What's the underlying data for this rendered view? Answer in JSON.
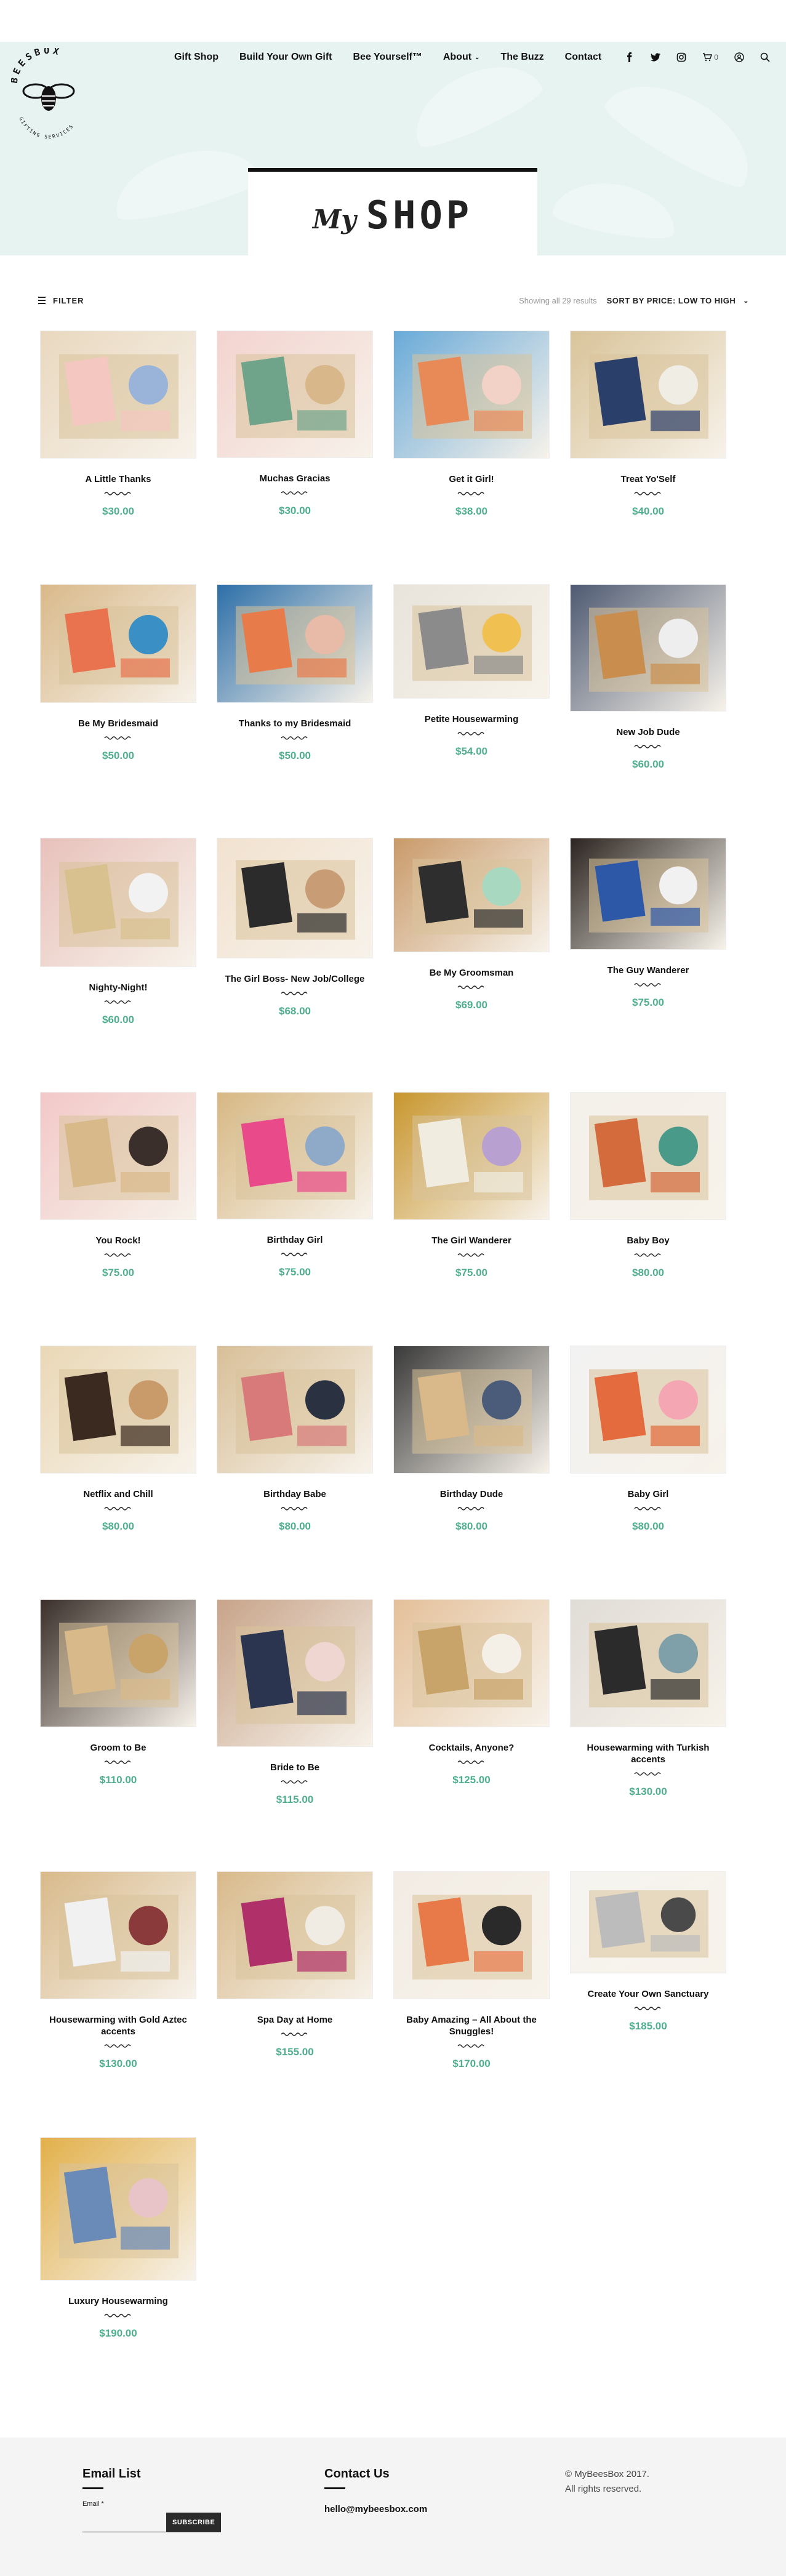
{
  "header": {
    "logo_text": "BEESBOX",
    "logo_subtext": "GIFTING SERVICES",
    "nav": [
      {
        "label": "Gift Shop"
      },
      {
        "label": "Build Your Own Gift"
      },
      {
        "label": "Bee Yourself™"
      },
      {
        "label": "About",
        "dropdown": true
      },
      {
        "label": "The Buzz"
      },
      {
        "label": "Contact"
      }
    ],
    "icons": [
      "facebook-icon",
      "twitter-icon",
      "instagram-icon",
      "cart-icon",
      "user-icon",
      "search-icon"
    ],
    "cart_count": "0"
  },
  "title": {
    "my": "My",
    "shop": "SHOP"
  },
  "toolbar": {
    "filter_label": "FILTER",
    "results_text": "Showing all 29 results",
    "sort_label": "SORT BY PRICE: LOW TO HIGH"
  },
  "colors": {
    "accent": "#4fae8e",
    "hero_bg": "#e6f3f1",
    "footer_bg": "#f4f4f4"
  },
  "products": [
    {
      "name": "A Little Thanks",
      "price": "$30.00"
    },
    {
      "name": "Muchas Gracias",
      "price": "$30.00"
    },
    {
      "name": "Get it Girl!",
      "price": "$38.00"
    },
    {
      "name": "Treat Yo'Self",
      "price": "$40.00"
    },
    {
      "name": "Be My Bridesmaid",
      "price": "$50.00"
    },
    {
      "name": "Thanks to my Bridesmaid",
      "price": "$50.00"
    },
    {
      "name": "Petite Housewarming",
      "price": "$54.00"
    },
    {
      "name": "New Job Dude",
      "price": "$60.00"
    },
    {
      "name": "Nighty-Night!",
      "price": "$60.00"
    },
    {
      "name": "The Girl Boss- New Job/College",
      "price": "$68.00"
    },
    {
      "name": "Be My Groomsman",
      "price": "$69.00"
    },
    {
      "name": "The Guy Wanderer",
      "price": "$75.00"
    },
    {
      "name": "You Rock!",
      "price": "$75.00"
    },
    {
      "name": "Birthday Girl",
      "price": "$75.00"
    },
    {
      "name": "The Girl Wanderer",
      "price": "$75.00"
    },
    {
      "name": "Baby Boy",
      "price": "$80.00"
    },
    {
      "name": "Netflix and Chill",
      "price": "$80.00"
    },
    {
      "name": "Birthday Babe",
      "price": "$80.00"
    },
    {
      "name": "Birthday Dude",
      "price": "$80.00"
    },
    {
      "name": "Baby Girl",
      "price": "$80.00"
    },
    {
      "name": "Groom to Be",
      "price": "$110.00"
    },
    {
      "name": "Bride to Be",
      "price": "$115.00"
    },
    {
      "name": "Cocktails, Anyone?",
      "price": "$125.00"
    },
    {
      "name": "Housewarming with Turkish accents",
      "price": "$130.00"
    },
    {
      "name": "Housewarming with Gold Aztec accents",
      "price": "$130.00"
    },
    {
      "name": "Spa Day at Home",
      "price": "$155.00"
    },
    {
      "name": "Baby Amazing – All About the Snuggles!",
      "price": "$170.00"
    },
    {
      "name": "Create Your Own Sanctuary",
      "price": "$185.00"
    },
    {
      "name": "Luxury Housewarming",
      "price": "$190.00"
    }
  ],
  "footer": {
    "email_heading": "Email List",
    "email_label": "Email *",
    "subscribe_label": "SUBSCRIBE",
    "contact_heading": "Contact Us",
    "contact_email": "hello@mybeesbox.com",
    "copyright_line1": "© MyBeesBox 2017.",
    "copyright_line2": "All rights reserved."
  }
}
